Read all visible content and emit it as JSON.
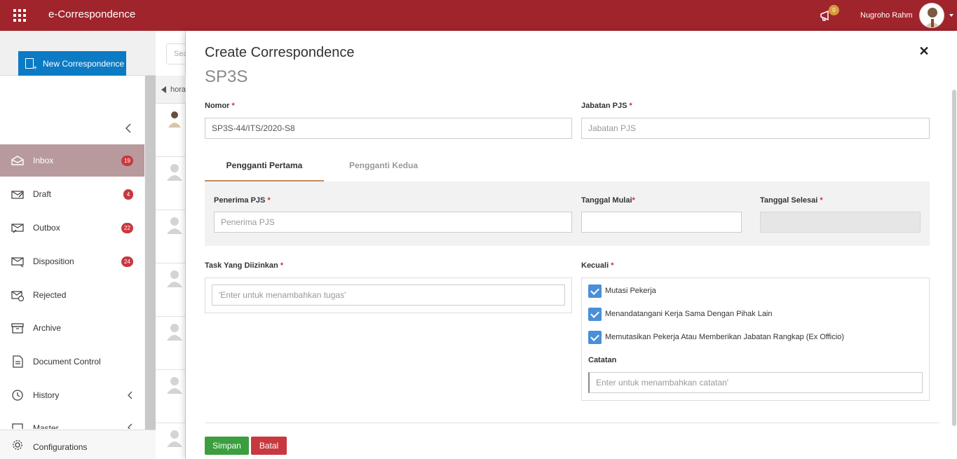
{
  "header": {
    "app_title": "e-Correspondence",
    "notification_count": "0",
    "user_name": "Nugroho Rahm"
  },
  "sidebar": {
    "new_button_label": "New Correspondence",
    "items": [
      {
        "label": "Inbox",
        "badge": "19",
        "icon": "inbox-icon",
        "active": true
      },
      {
        "label": "Draft",
        "badge": "4",
        "icon": "draft-icon"
      },
      {
        "label": "Outbox",
        "badge": "22",
        "icon": "outbox-icon"
      },
      {
        "label": "Disposition",
        "badge": "24",
        "icon": "disposition-icon"
      },
      {
        "label": "Rejected",
        "icon": "rejected-icon"
      },
      {
        "label": "Archive",
        "icon": "archive-icon"
      },
      {
        "label": "Document Control",
        "icon": "document-control-icon"
      },
      {
        "label": "History",
        "icon": "history-icon"
      },
      {
        "label": "Master",
        "icon": "master-icon"
      }
    ],
    "configurations_label": "Configurations"
  },
  "middle": {
    "search_placeholder": "Search",
    "tab_text": "hora"
  },
  "modal": {
    "title": "Create Correspondence",
    "subtitle": "SP3S",
    "nomor_label": "Nomor",
    "nomor_value": "SP3S-44/ITS/2020-S8",
    "jabatan_label": "Jabatan PJS",
    "jabatan_placeholder": "Jabatan PJS",
    "tabs": [
      "Pengganti Pertama",
      "Pengganti Kedua"
    ],
    "penerima_label": "Penerima PJS",
    "penerima_placeholder": "Penerima PJS",
    "tanggal_mulai_label": "Tanggal Mulai",
    "tanggal_selesai_label": "Tanggal Selesai",
    "task_label": "Task Yang Diizinkan",
    "task_placeholder": "'Enter untuk menambahkan tugas'",
    "kecuali_label": "Kecuali",
    "kecuali_options": [
      "Mutasi Pekerja",
      "Menandatangani Kerja Sama Dengan Pihak Lain",
      "Memutasikan Pekerja Atau Memberikan Jabatan Rangkap (Ex Officio)"
    ],
    "catatan_label": "Catatan",
    "catatan_placeholder": "Enter untuk menambahkan catatan'",
    "save_label": "Simpan",
    "cancel_label": "Batal"
  },
  "colors": {
    "brand": "#a0242c",
    "primary_button": "#0c7bc4",
    "save": "#3c9f3f",
    "cancel": "#c8393f",
    "badge": "#c8393f",
    "checkbox": "#4a8fd8"
  }
}
